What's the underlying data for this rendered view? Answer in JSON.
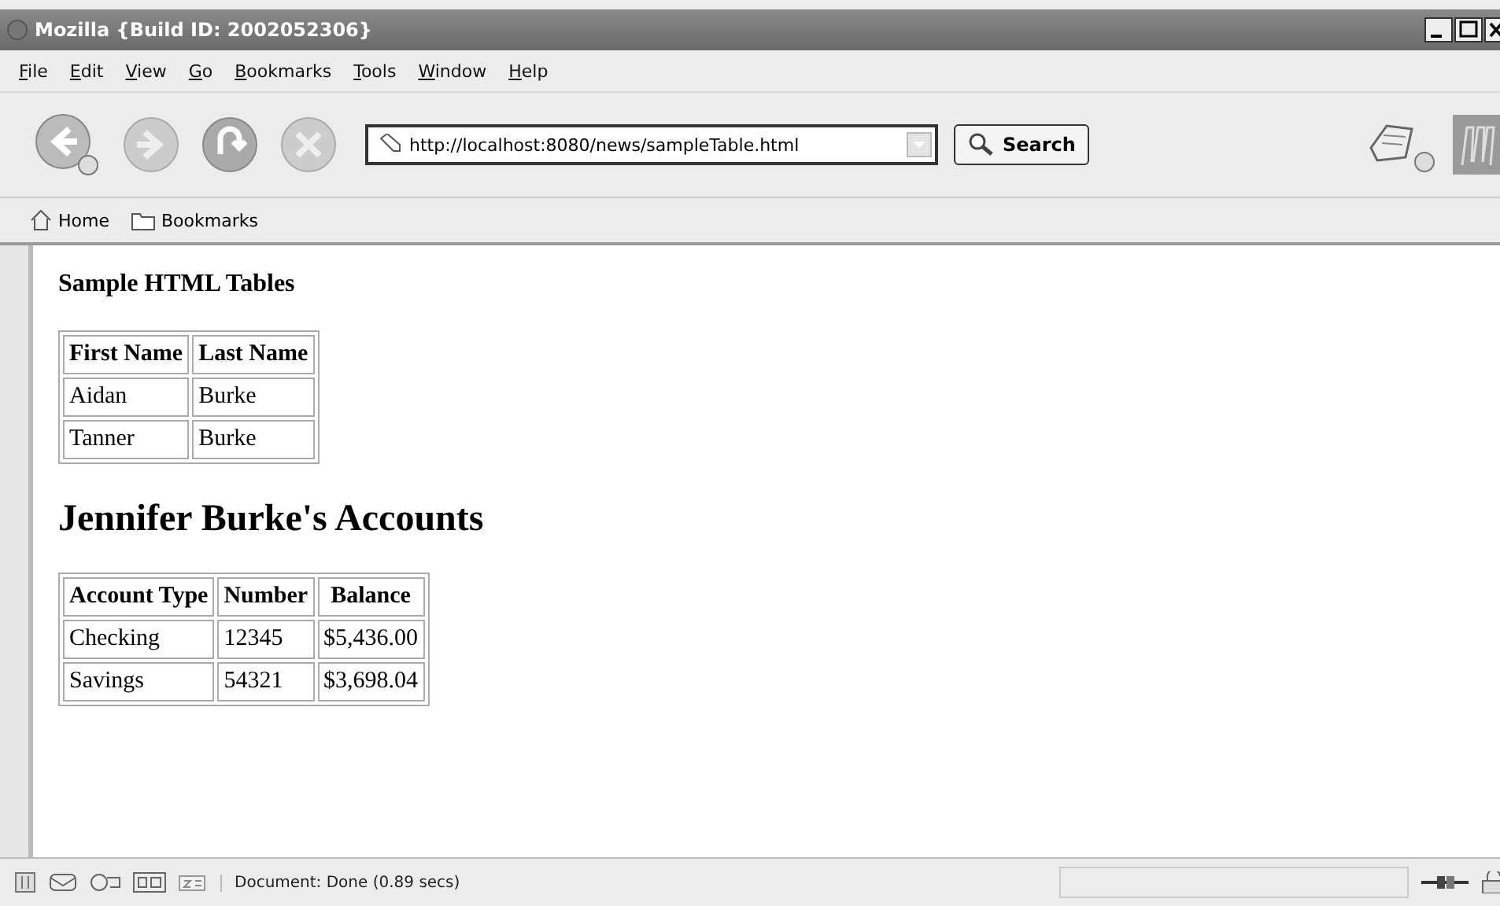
{
  "window": {
    "title": "Mozilla {Build ID: 2002052306}"
  },
  "menu": [
    "File",
    "Edit",
    "View",
    "Go",
    "Bookmarks",
    "Tools",
    "Window",
    "Help"
  ],
  "navigation": {
    "url": "http://localhost:8080/news/sampleTable.html",
    "search_button": "Search"
  },
  "personal_toolbar": [
    "Home",
    "Bookmarks"
  ],
  "page": {
    "heading": "Sample HTML Tables",
    "tables": [
      {
        "columns": [
          "First Name",
          "Last Name"
        ],
        "rows": [
          [
            "Aidan",
            "Burke"
          ],
          [
            "Tanner",
            "Burke"
          ]
        ]
      },
      {
        "title": "Jennifer Burke's Accounts",
        "columns": [
          "Account Type",
          "Number",
          "Balance"
        ],
        "rows": [
          [
            "Checking",
            "12345",
            "$5,436.00"
          ],
          [
            "Savings",
            "54321",
            "$3,698.04"
          ]
        ]
      }
    ]
  },
  "status_bar": {
    "text": "Document: Done (0.89 secs)"
  }
}
